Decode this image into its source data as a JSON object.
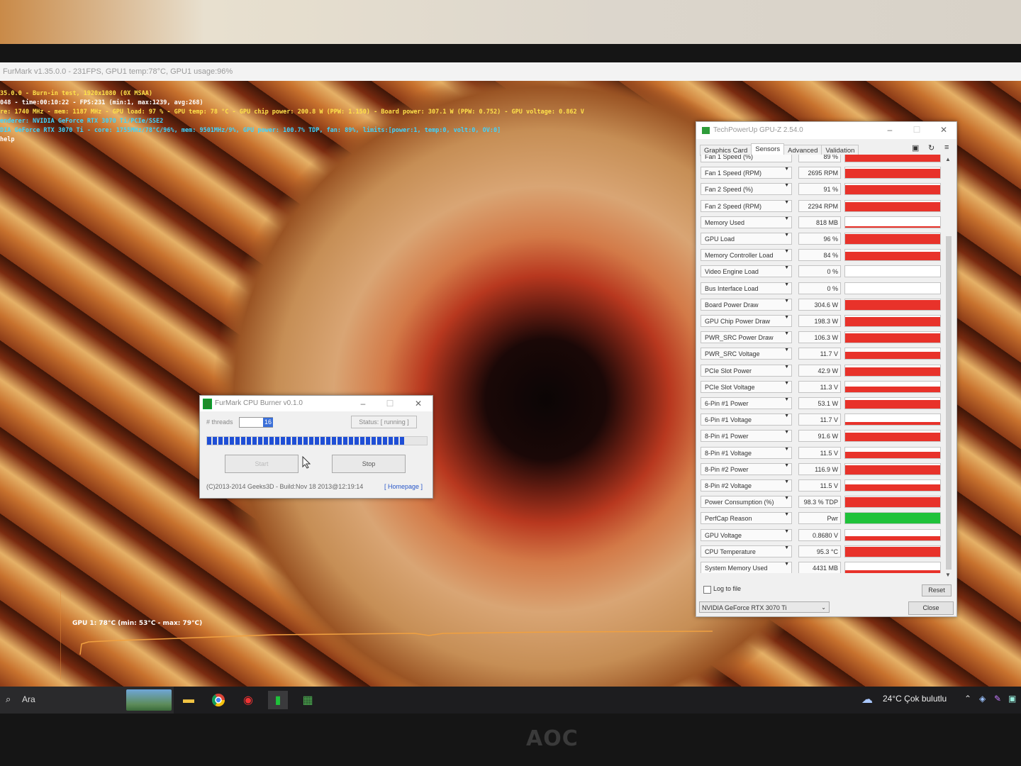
{
  "furmark": {
    "window_title": "FurMark v1.35.0.0 - 231FPS, GPU1 temp:78°C, GPU1 usage:96%",
    "osd": [
      {
        "text": "35.0.0 - Burn-in test, 1920x1080 (0X MSAA)",
        "color": "yellow"
      },
      {
        "text": "048 - time:00:10:22 - FPS:231 (min:1, max:1239, avg:268)",
        "color": "white"
      },
      {
        "text": "re: 1740 MHz - mem: 1187 MHz - GPU load: 97 % - GPU temp: 78 °C - GPU chip power: 200.8 W (PPW: 1.150) - Board power: 307.1 W (PPW: 0.752) - GPU voltage: 0.862 V",
        "color": "yellow"
      },
      {
        "text": "enderer: NVIDIA GeForce RTX 3070 Ti/PCIe/SSE2",
        "color": "cyan"
      },
      {
        "text": "DIA GeForce RTX 3070 Ti - core: 1755MHz/78°C/96%, mem: 9501MHz/9%, GPU power: 100.7% TDP, fan: 89%, limits:[power:1, temp:0, volt:0, OV:0]",
        "color": "cyan"
      },
      {
        "text": "help",
        "color": "white"
      }
    ],
    "graph_label": "GPU 1: 78°C (min: 53°C - max: 79°C)"
  },
  "cpu_burner": {
    "title": "FurMark CPU Burner v0.1.0",
    "threads_label": "# threads",
    "threads_value": "16",
    "status": "Status: [ running ]",
    "start_label": "Start",
    "stop_label": "Stop",
    "copyright": "(C)2013-2014 Geeks3D - Build:Nov 18 2013@12:19:14",
    "homepage": "[ Homepage ]",
    "progress": 0.9
  },
  "gpuz": {
    "title": "TechPowerUp GPU-Z 2.54.0",
    "tabs": [
      "Graphics Card",
      "Sensors",
      "Advanced",
      "Validation"
    ],
    "active_tab": "Sensors",
    "sensors": [
      {
        "name": "Fan 1 Speed (%)",
        "value": "89 %",
        "level": 0.89,
        "color": "#e8322a"
      },
      {
        "name": "Fan 1 Speed (RPM)",
        "value": "2695 RPM",
        "level": 0.85,
        "color": "#e8322a"
      },
      {
        "name": "Fan 2 Speed (%)",
        "value": "91 %",
        "level": 0.91,
        "color": "#e8322a"
      },
      {
        "name": "Fan 2 Speed (RPM)",
        "value": "2294 RPM",
        "level": 0.85,
        "color": "#e8322a"
      },
      {
        "name": "Memory Used",
        "value": "818 MB",
        "level": 0.1,
        "color": "#e8322a"
      },
      {
        "name": "GPU Load",
        "value": "96 %",
        "level": 0.96,
        "color": "#e8322a"
      },
      {
        "name": "Memory Controller Load",
        "value": "84 %",
        "level": 0.84,
        "color": "#e8322a"
      },
      {
        "name": "Video Engine Load",
        "value": "0 %",
        "level": 0,
        "color": "#e8322a"
      },
      {
        "name": "Bus Interface Load",
        "value": "0 %",
        "level": 0,
        "color": "#e8322a"
      },
      {
        "name": "Board Power Draw",
        "value": "304.6 W",
        "level": 0.9,
        "color": "#e8322a"
      },
      {
        "name": "GPU Chip Power Draw",
        "value": "198.3 W",
        "level": 0.85,
        "color": "#e8322a"
      },
      {
        "name": "PWR_SRC Power Draw",
        "value": "106.3 W",
        "level": 0.85,
        "color": "#e8322a"
      },
      {
        "name": "PWR_SRC Voltage",
        "value": "11.7 V",
        "level": 0.7,
        "color": "#e8322a"
      },
      {
        "name": "PCIe Slot Power",
        "value": "42.9 W",
        "level": 0.75,
        "color": "#e8322a"
      },
      {
        "name": "PCIe Slot Voltage",
        "value": "11.3 V",
        "level": 0.5,
        "color": "#e8322a"
      },
      {
        "name": "6-Pin #1 Power",
        "value": "53.1 W",
        "level": 0.8,
        "color": "#e8322a"
      },
      {
        "name": "6-Pin #1 Voltage",
        "value": "11.7 V",
        "level": 0.3,
        "color": "#e8322a"
      },
      {
        "name": "8-Pin #1 Power",
        "value": "91.6 W",
        "level": 0.8,
        "color": "#e8322a"
      },
      {
        "name": "8-Pin #1 Voltage",
        "value": "11.5 V",
        "level": 0.6,
        "color": "#e8322a"
      },
      {
        "name": "8-Pin #2 Power",
        "value": "116.9 W",
        "level": 0.85,
        "color": "#e8322a"
      },
      {
        "name": "8-Pin #2 Voltage",
        "value": "11.5 V",
        "level": 0.6,
        "color": "#e8322a"
      },
      {
        "name": "Power Consumption (%)",
        "value": "98.3 % TDP",
        "level": 0.95,
        "color": "#e8322a"
      },
      {
        "name": "PerfCap Reason",
        "value": "Pwr",
        "level": 1,
        "color": "#1fc23a"
      },
      {
        "name": "GPU Voltage",
        "value": "0.8680 V",
        "level": 0.4,
        "color": "#e8322a"
      },
      {
        "name": "CPU Temperature",
        "value": "95.3 °C",
        "level": 0.95,
        "color": "#e8322a"
      },
      {
        "name": "System Memory Used",
        "value": "4431 MB",
        "level": 0.3,
        "color": "#e8322a"
      }
    ],
    "log_label": "Log to file",
    "reset_label": "Reset",
    "device": "NVIDIA GeForce RTX 3070 Ti",
    "close_label": "Close"
  },
  "taskbar": {
    "search_label": "Ara",
    "weather": "24°C  Çok bulutlu"
  },
  "monitor": {
    "brand": "AOC"
  }
}
